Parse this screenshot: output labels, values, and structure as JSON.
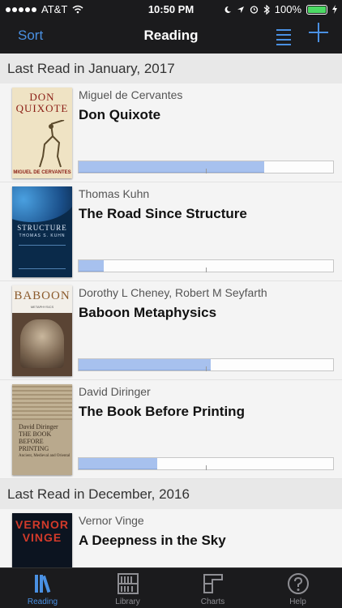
{
  "status_bar": {
    "carrier": "AT&T",
    "time": "10:50 PM",
    "battery": "100%",
    "icons": [
      "signal-dots-icon",
      "wifi-icon",
      "moon-icon",
      "location-arrow-icon",
      "alarm-icon",
      "bluetooth-icon",
      "battery-icon",
      "charging-bolt-icon"
    ]
  },
  "nav": {
    "sort_label": "Sort",
    "title": "Reading",
    "list_icon": "list-icon",
    "add_icon": "plus-icon"
  },
  "sections": [
    {
      "header": "Last Read in January, 2017",
      "books": [
        {
          "author": "Miguel de Cervantes",
          "title": "Don Quixote",
          "progress": 0.73,
          "cover": {
            "line1": "DON",
            "line2": "QUIXOTE",
            "bottom": "MIGUEL DE CERVANTES"
          }
        },
        {
          "author": "Thomas Kuhn",
          "title": "The Road Since Structure",
          "progress": 0.1,
          "cover": {
            "line1": "STRUCTURE",
            "line2": "THOMAS S. KUHN"
          }
        },
        {
          "author": "Dorothy L Cheney, Robert M Seyfarth",
          "title": "Baboon Metaphysics",
          "progress": 0.52,
          "cover": {
            "line1": "BABOON",
            "line2": "METAPHYSICS"
          }
        },
        {
          "author": "David Diringer",
          "title": "The Book Before Printing",
          "progress": 0.31,
          "cover": {
            "line1": "David Diringer",
            "line2": "THE BOOK BEFORE PRINTING",
            "line3": "Ancient, Medieval and Oriental"
          }
        }
      ]
    },
    {
      "header": "Last Read in December, 2016",
      "books": [
        {
          "author": "Vernor Vinge",
          "title": "A Deepness in the Sky",
          "cover": {
            "line1": "VERNOR",
            "line2": "VINGE"
          }
        }
      ]
    }
  ],
  "tabs": [
    {
      "label": "Reading",
      "icon": "books-icon",
      "active": true
    },
    {
      "label": "Library",
      "icon": "bookshelf-icon",
      "active": false
    },
    {
      "label": "Charts",
      "icon": "chart-icon",
      "active": false
    },
    {
      "label": "Help",
      "icon": "question-circle-icon",
      "active": false
    }
  ],
  "colors": {
    "accent": "#4a90e2",
    "progress_fill": "#a7c1ee",
    "bar_bg": "#1b1b1d"
  }
}
